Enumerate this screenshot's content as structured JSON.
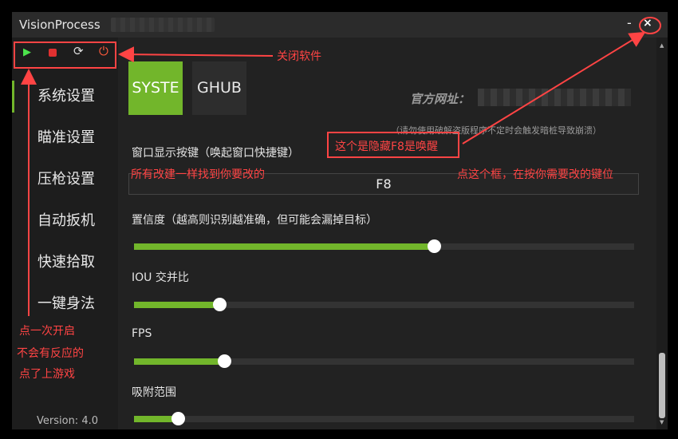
{
  "window": {
    "title": "VisionProcess",
    "minimize": "-",
    "close": "×"
  },
  "toolbar": {
    "icons": [
      "play-icon",
      "stop-icon",
      "refresh-icon",
      "power-icon"
    ],
    "play_glyph": "▶",
    "refresh_glyph": "⟳",
    "power_glyph": "⏻"
  },
  "sidebar": {
    "items": [
      {
        "label": "系统设置",
        "active": true
      },
      {
        "label": "瞄准设置"
      },
      {
        "label": "压枪设置"
      },
      {
        "label": "自动扳机"
      },
      {
        "label": "快速拾取"
      },
      {
        "label": "一键身法"
      }
    ],
    "version": "Version: 4.0"
  },
  "tabs": [
    {
      "label": "SYSTE",
      "active": true
    },
    {
      "label": "GHUB"
    }
  ],
  "site": {
    "label": "官方网址：",
    "warning": "（请勿使用破解盗版程序不定时会触发暗桩导致崩溃）"
  },
  "settings": {
    "hotkey_label": "窗口显示按键（唤起窗口快捷键）",
    "hotkey_value": "F8",
    "sliders": [
      {
        "label": "置信度（越高则识别越准确，但可能会漏掉目标）",
        "value": 0.6
      },
      {
        "label": "IOU 交并比",
        "value": 0.17
      },
      {
        "label": "FPS",
        "value": 0.18
      },
      {
        "label": "吸附范围",
        "value": 0.087
      }
    ]
  },
  "annotations": {
    "close_software": "关闭软件",
    "hide_f8": "这个是隐藏F8是唤醒",
    "change_all": "所有改建一样找到你要改的",
    "click_box": "点这个框，在按你需要改的键位",
    "start_line1": "点一次开启",
    "start_line2": "不会有反应的",
    "start_line3": "点了上游戏"
  },
  "colors": {
    "accent": "#72b62b",
    "annotation": "#ff4444",
    "background": "#222222"
  }
}
